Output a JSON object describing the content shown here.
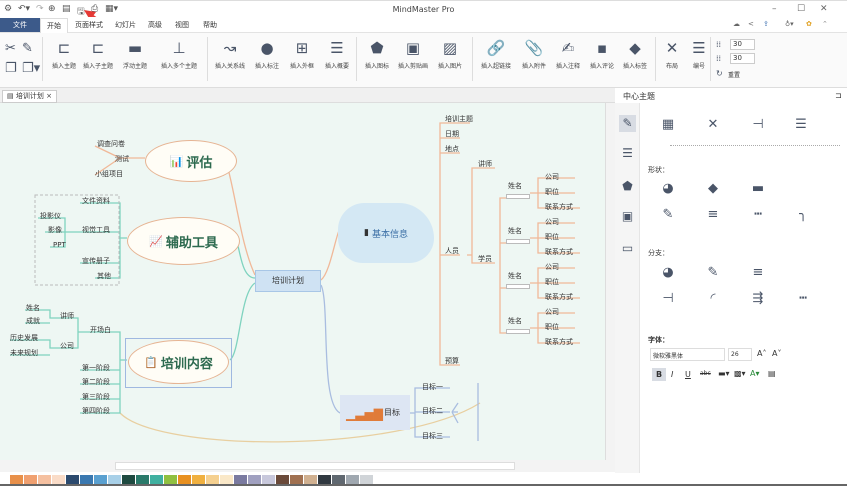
{
  "app": {
    "title": "MindMaster Pro"
  },
  "menu": {
    "file": "文件",
    "tabs": [
      "开始",
      "页面样式",
      "幻灯片",
      "高级",
      "视图",
      "帮助"
    ]
  },
  "ribbon": {
    "buttons": [
      "插入主题",
      "插入子主题",
      "浮动主题",
      "插入多个主题",
      "插入关系线",
      "插入标注",
      "插入外框",
      "插入概要",
      "插入图标",
      "插入剪贴画",
      "插入图片",
      "插入超链接",
      "插入附件",
      "插入注释",
      "插入评论",
      "插入标签",
      "布局",
      "编号"
    ],
    "spacing_h": "30",
    "spacing_v": "30",
    "reset": "重置"
  },
  "document": {
    "tab": "培训计划"
  },
  "mindmap": {
    "central": "培训计划",
    "eval": {
      "title": "评估",
      "children": [
        "调查问卷",
        "测试",
        "小组项目"
      ]
    },
    "tools": {
      "title": "辅助工具",
      "children": [
        "文件资料",
        "视觉工具",
        "宣传册子",
        "其他"
      ],
      "visual": [
        "投影仪",
        "影像",
        "PPT"
      ]
    },
    "content": {
      "title": "培训内容",
      "opening": "开场白",
      "lecturer": "讲师",
      "lecturer_items": [
        "姓名",
        "成就"
      ],
      "company": "公司",
      "company_items": [
        "历史发展",
        "未来规划"
      ],
      "stages": [
        "第一阶段",
        "第二阶段",
        "第三阶段",
        "第四阶段"
      ]
    },
    "info": {
      "title": "基本信息",
      "children": [
        "培训主题",
        "日期",
        "地点",
        "人员",
        "预算"
      ],
      "lecturer": "讲师",
      "students": "学员",
      "student_name": "姓名",
      "student_fields": [
        "公司",
        "职位",
        "联系方式"
      ]
    },
    "goal": {
      "title": "目标",
      "children": [
        "目标一",
        "目标二",
        "目标三"
      ]
    }
  },
  "panel": {
    "title": "中心主题",
    "shape": "形状：",
    "branch": "分支：",
    "font": "字体：",
    "font_name": "微软雅黑体",
    "font_size": "26",
    "format": [
      "B",
      "I",
      "U",
      "abc"
    ]
  },
  "colors": {
    "accent": "#3c5a8a",
    "canvas": "#eef7f3"
  }
}
